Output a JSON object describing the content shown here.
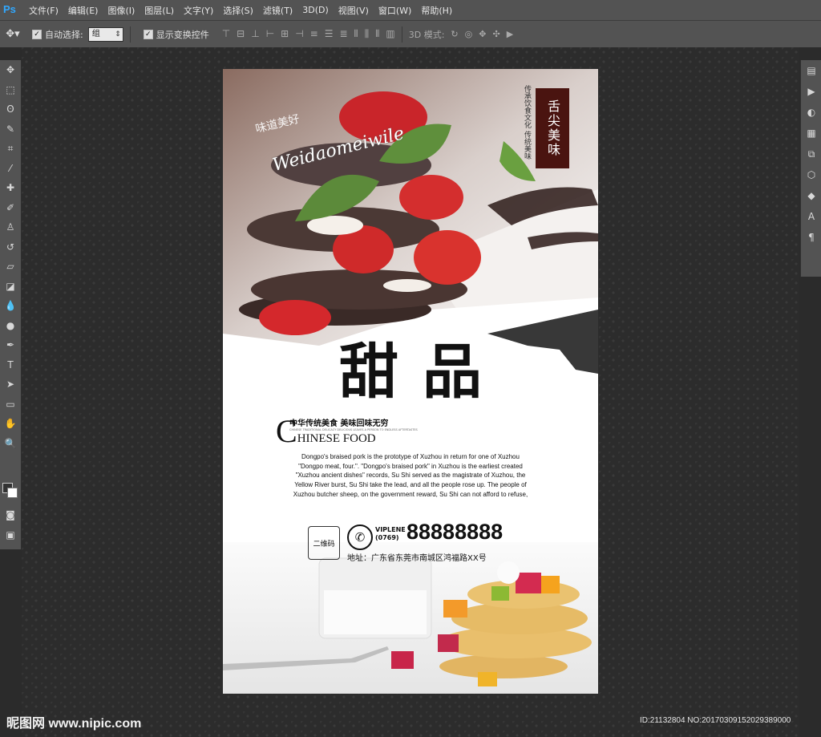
{
  "app": {
    "logo": "Ps"
  },
  "menu": [
    "文件(F)",
    "编辑(E)",
    "图像(I)",
    "图层(L)",
    "文字(Y)",
    "选择(S)",
    "滤镜(T)",
    "3D(D)",
    "视图(V)",
    "窗口(W)",
    "帮助(H)"
  ],
  "options": {
    "auto_select_label": "自动选择:",
    "auto_select_value": "组",
    "show_transform_label": "显示变换控件",
    "mode_3d_label": "3D 模式:"
  },
  "poster": {
    "seal_text": "舌尖美味",
    "side_text": "传承饮食文化 传统美味",
    "script_cn": "味道美好",
    "script_en": "Weidaomeiwile",
    "big_title": "甜品",
    "subtitle_cn": "中华传统美食  美味回味无穷",
    "subtitle_small": "CHINESE TRADITIONAL DELICACY DELICIOUS LEAVES A PERSON TO ENDLESS AFTERTASTES",
    "subtitle_en_initial": "C",
    "subtitle_en_rest": "HINESE FOOD",
    "description": "Dongpo's braised pork is the prototype of Xuzhou in return for one of Xuzhou \"Dongpo meat, four.\". \"Dongpo's braised pork\" in Xuzhou is the earliest created \"Xuzhou ancient dishes\" records, Su Shi served as the magistrate of Xuzhou, the Yellow River burst, Su Shi take the lead, and all the people rose up. The people of Xuzhou butcher sheep, on the government reward, Su Shi can not afford to refuse,",
    "qr_label": "二维码",
    "phone_label_top": "VIPLENE",
    "phone_label_bottom": "(0769)",
    "phone_number": "88888888",
    "address": "地址：广东省东莞市南城区鸿福路XX号"
  },
  "watermark": {
    "left": "昵图网 www.nipic.com",
    "right": "ID:21132804 NO:20170309152029389000"
  },
  "colors": {
    "ui_bg": "#535353",
    "canvas_bg": "#2c2c2c",
    "seal": "#4a1410",
    "ps_blue": "#31a8ff"
  }
}
